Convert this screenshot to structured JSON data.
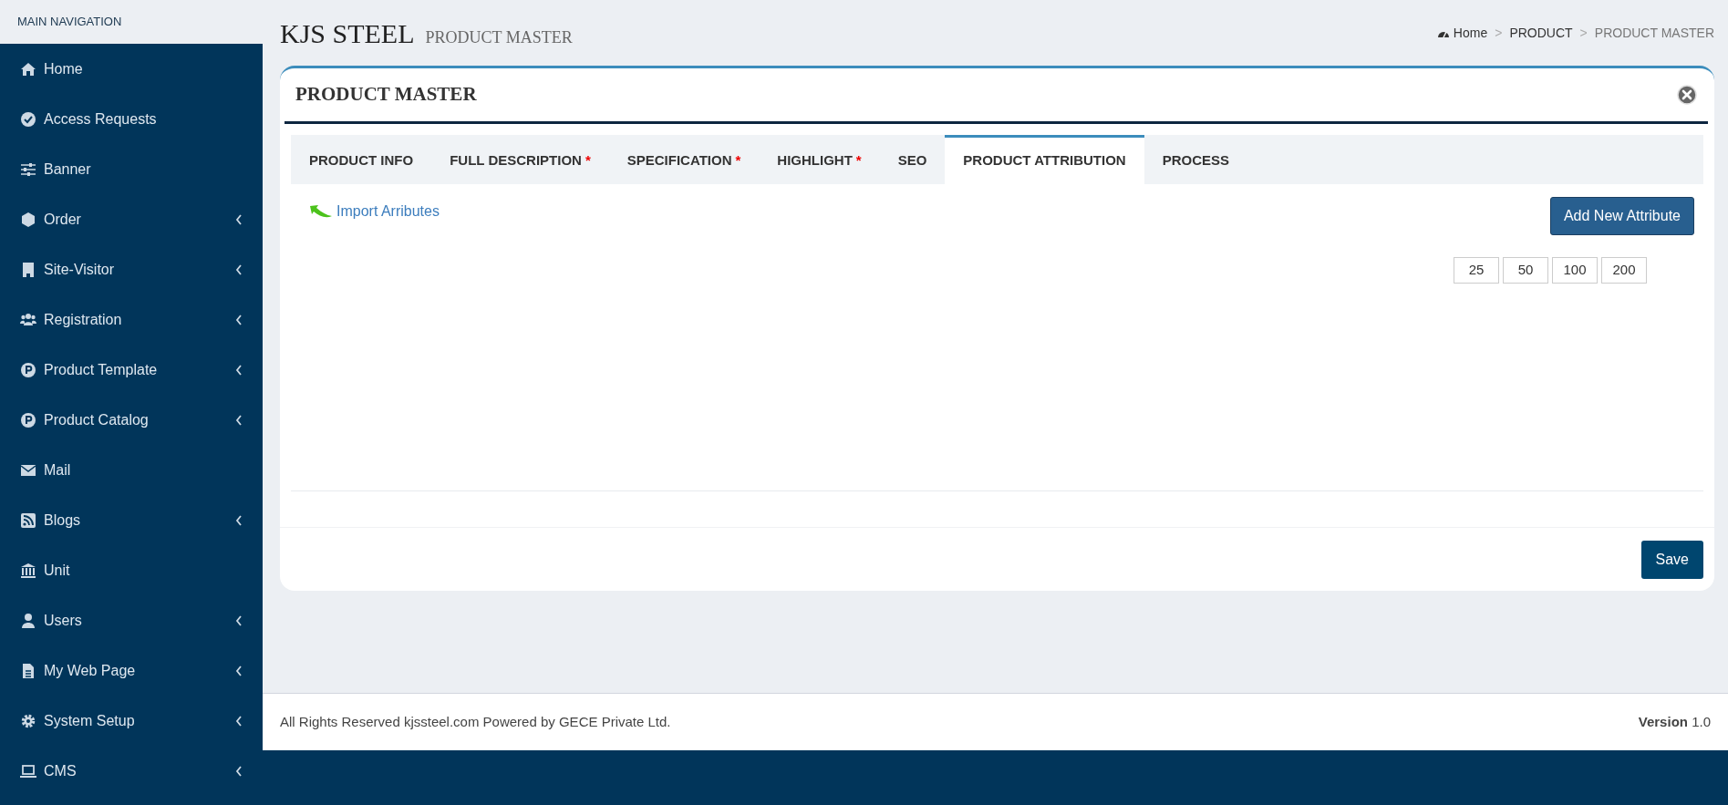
{
  "sidebar": {
    "header": "MAIN NAVIGATION",
    "items": [
      {
        "label": "Home",
        "has_submenu": false
      },
      {
        "label": "Access Requests",
        "has_submenu": false
      },
      {
        "label": "Banner",
        "has_submenu": false
      },
      {
        "label": "Order",
        "has_submenu": true
      },
      {
        "label": "Site-Visitor",
        "has_submenu": true
      },
      {
        "label": "Registration",
        "has_submenu": true
      },
      {
        "label": "Product Template",
        "has_submenu": true
      },
      {
        "label": "Product Catalog",
        "has_submenu": true
      },
      {
        "label": "Mail",
        "has_submenu": false
      },
      {
        "label": "Blogs",
        "has_submenu": true
      },
      {
        "label": "Unit",
        "has_submenu": false
      },
      {
        "label": "Users",
        "has_submenu": true
      },
      {
        "label": "My Web Page",
        "has_submenu": true
      },
      {
        "label": "System Setup",
        "has_submenu": true
      },
      {
        "label": "CMS",
        "has_submenu": true
      }
    ]
  },
  "header": {
    "title": "KJS STEEL",
    "subtitle": "PRODUCT MASTER"
  },
  "breadcrumb": [
    {
      "label": "Home",
      "separator": ">"
    },
    {
      "label": "PRODUCT",
      "separator": ">"
    },
    {
      "label": "PRODUCT MASTER"
    }
  ],
  "card": {
    "title": "PRODUCT MASTER",
    "tabs": [
      {
        "label": "PRODUCT INFO",
        "selected": false
      },
      {
        "label": "FULL DESCRIPTION",
        "required_mark": "*",
        "selected": false
      },
      {
        "label": "SPECIFICATION",
        "required_mark": "*",
        "selected": false
      },
      {
        "label": "HIGHLIGHT",
        "required_mark": "*",
        "selected": false
      },
      {
        "label": "SEO",
        "selected": false
      },
      {
        "label": "PRODUCT ATTRIBUTION",
        "selected": true
      },
      {
        "label": "PROCESS",
        "selected": false
      }
    ],
    "import_link": "Import Arributes",
    "add_button": "Add New Attribute",
    "page_sizes": [
      "25",
      "50",
      "100",
      "200"
    ],
    "save_button": "Save"
  },
  "footer": {
    "text": "All Rights Reserved kjssteel.com Powered by GECE Private Ltd.",
    "version_label": "Version",
    "version": "1.0"
  }
}
